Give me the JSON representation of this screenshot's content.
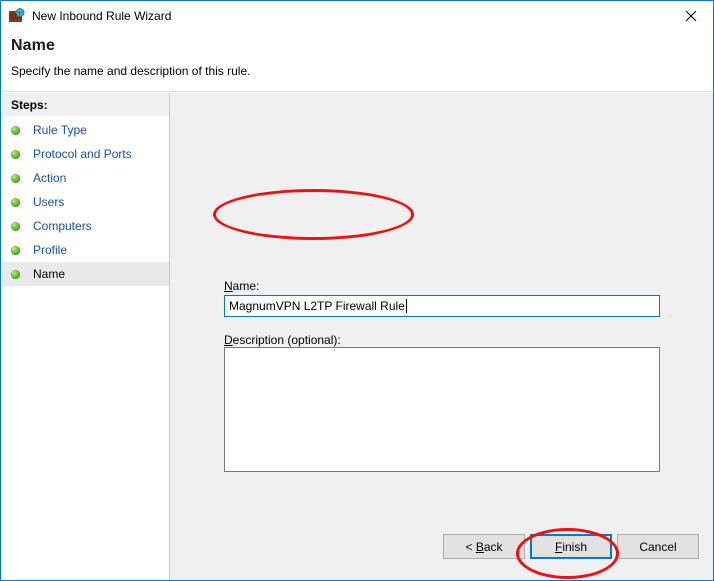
{
  "window": {
    "title": "New Inbound Rule Wizard",
    "icon": "firewall-brick-globe-icon",
    "close_label": "✕",
    "border_color": "#0078d7"
  },
  "header": {
    "heading": "Name",
    "subtitle": "Specify the name and description of this rule."
  },
  "sidebar": {
    "header": "Steps:",
    "items": [
      {
        "label": "Rule Type",
        "current": false
      },
      {
        "label": "Protocol and Ports",
        "current": false
      },
      {
        "label": "Action",
        "current": false
      },
      {
        "label": "Users",
        "current": false
      },
      {
        "label": "Computers",
        "current": false
      },
      {
        "label": "Profile",
        "current": false
      },
      {
        "label": "Name",
        "current": true
      }
    ],
    "bullet_color": "#62c72b",
    "link_color": "#1a4f9c"
  },
  "form": {
    "name_label": "Name:",
    "name_value": "MagnumVPN L2TP Firewall Rule",
    "name_placeholder": "",
    "description_label": "Description (optional):",
    "description_value": "",
    "description_placeholder": ""
  },
  "footer": {
    "back_label": "< Back",
    "back_mnemonic": "B",
    "finish_label": "Finish",
    "finish_mnemonic": "F",
    "cancel_label": "Cancel",
    "focused_button": "Finish"
  },
  "annotations": {
    "color": "#ee1111",
    "shapes": [
      {
        "name": "name-field-highlight",
        "target": "name-input"
      },
      {
        "name": "finish-button-highlight",
        "target": "finish-button"
      }
    ]
  }
}
